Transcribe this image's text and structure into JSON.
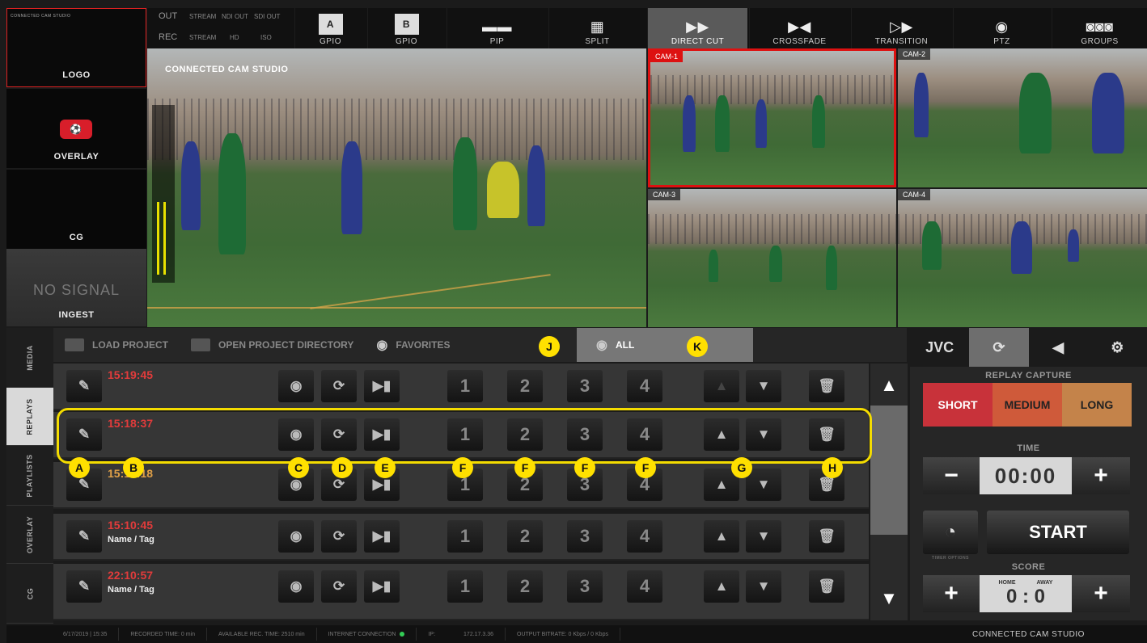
{
  "sources": {
    "logo": {
      "label": "LOGO",
      "thumb_text": "CONNECTED CAM STUDIO"
    },
    "overlay": {
      "label": "OVERLAY"
    },
    "cg": {
      "label": "CG"
    },
    "ingest": {
      "label": "INGEST",
      "status": "NO SIGNAL"
    }
  },
  "topbar": {
    "out_label": "OUT",
    "rec_label": "REC",
    "out_stream": "STREAM",
    "out_ndi": "NDI OUT",
    "out_sdi": "SDI OUT",
    "rec_stream": "STREAM",
    "rec_hd": "HD",
    "rec_iso": "ISO",
    "buttons": [
      {
        "label": "GPIO",
        "badge": "A"
      },
      {
        "label": "GPIO",
        "badge": "B"
      },
      {
        "label": "PIP"
      },
      {
        "label": "SPLIT"
      },
      {
        "label": "DIRECT CUT"
      },
      {
        "label": "CROSSFADE"
      },
      {
        "label": "TRANSITION"
      },
      {
        "label": "PTZ"
      },
      {
        "label": "GROUPS"
      }
    ]
  },
  "program": {
    "title": "CONNECTED CAM STUDIO"
  },
  "cams": [
    {
      "label": "CAM-1"
    },
    {
      "label": "CAM-2"
    },
    {
      "label": "CAM-3"
    },
    {
      "label": "CAM-4"
    }
  ],
  "tabs": {
    "load_project": "LOAD PROJECT",
    "open_dir": "OPEN PROJECT DIRECTORY",
    "favorites": "FAVORITES",
    "all": "ALL"
  },
  "side_tabs": [
    "MEDIA",
    "REPLAYS",
    "PLAYLISTS",
    "OVERLAY",
    "CG"
  ],
  "replays": [
    {
      "time": "15:19:45",
      "tag": ""
    },
    {
      "time": "15:18:37",
      "tag": ""
    },
    {
      "time": "15:12:18",
      "tag": ""
    },
    {
      "time": "15:10:45",
      "tag": "Name / Tag"
    },
    {
      "time": "22:10:57",
      "tag": "Name / Tag"
    }
  ],
  "row_numbers": [
    "1",
    "2",
    "3",
    "4"
  ],
  "right_panel": {
    "brand": "JVC",
    "replay_capture": "REPLAY CAPTURE",
    "short": "SHORT",
    "medium": "MEDIUM",
    "long": "LONG",
    "time_label": "TIME",
    "time_value": "00:00",
    "start": "START",
    "timer_options": "TIMER OPTIONS",
    "score_label": "SCORE",
    "home": "HOME",
    "away": "AWAY",
    "score_value": "0 : 0",
    "minus": "−",
    "plus": "+"
  },
  "status": {
    "date": "6/17/2019 | 15:35",
    "recorded": "RECORDED TIME: 0 min",
    "available": "AVAILABLE REC. TIME: 2510 min",
    "internet": "INTERNET CONNECTION",
    "ip_label": "IP:",
    "ip": "172.17.3.36",
    "bitrate": "OUTPUT BITRATE:   0 Kbps / 0 Kbps"
  },
  "footer_brand": "CONNECTED CAM STUDIO",
  "annotations": [
    "A",
    "B",
    "C",
    "D",
    "E",
    "F",
    "F",
    "F",
    "F",
    "G",
    "H",
    "J",
    "K"
  ],
  "colors": {
    "accent_red": "#e23b3b",
    "short": "#c8323a",
    "medium": "#cf5a3a",
    "long": "#c4834a",
    "annotation": "#ffe000"
  }
}
